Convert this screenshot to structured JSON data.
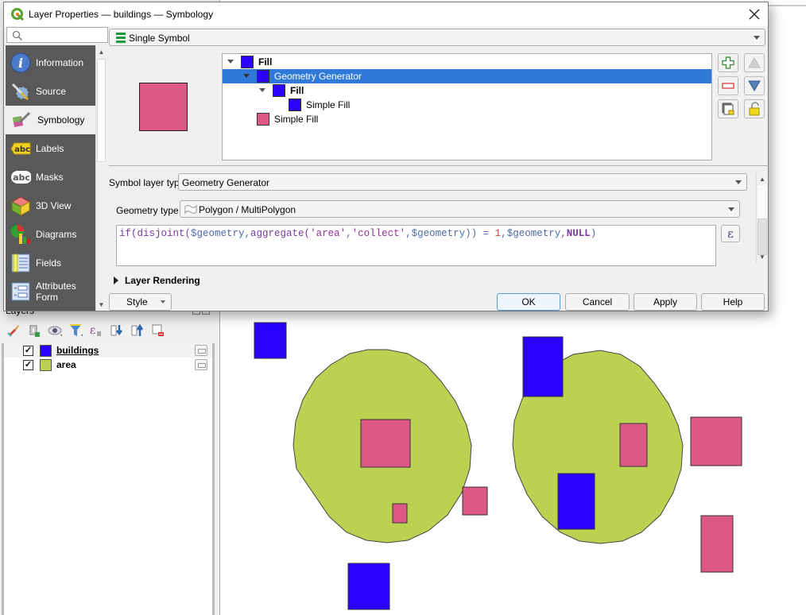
{
  "dialog": {
    "title": "Layer Properties — buildings — Symbology",
    "search_placeholder": "",
    "sidebar": {
      "items": [
        {
          "label": "Information",
          "icon": "information-icon"
        },
        {
          "label": "Source",
          "icon": "source-icon"
        },
        {
          "label": "Symbology",
          "icon": "symbology-icon",
          "active": true
        },
        {
          "label": "Labels",
          "icon": "labels-icon"
        },
        {
          "label": "Masks",
          "icon": "masks-icon"
        },
        {
          "label": "3D View",
          "icon": "3d-view-icon"
        },
        {
          "label": "Diagrams",
          "icon": "diagrams-icon"
        },
        {
          "label": "Fields",
          "icon": "fields-icon"
        },
        {
          "label": "Attributes Form",
          "label_line1": "Attributes",
          "label_line2": "Form",
          "icon": "attributes-form-icon"
        }
      ]
    },
    "renderer": {
      "label": "Single Symbol",
      "icon": "single-symbol-icon"
    },
    "preview_color": "#de5887",
    "symbol_tree": [
      {
        "label": "Fill",
        "bold": true,
        "level": 0,
        "expanded": true,
        "color": "#2a00ff"
      },
      {
        "label": "Geometry Generator",
        "bold": false,
        "level": 1,
        "expanded": true,
        "color": "#2a00ff",
        "selected": true
      },
      {
        "label": "Fill",
        "bold": true,
        "level": 2,
        "expanded": true,
        "color": "#2a00ff"
      },
      {
        "label": "Simple Fill",
        "bold": false,
        "level": 3,
        "color": "#2a00ff"
      },
      {
        "label": "Simple Fill",
        "bold": false,
        "level": 1,
        "color": "#de5887"
      }
    ],
    "layer_buttons": {
      "add": "add-symbol-layer",
      "remove": "remove-symbol-layer",
      "duplicate": "duplicate-symbol-layer",
      "move_up": "move-up",
      "move_down": "move-down",
      "lock": "lock-layer"
    },
    "symbol_layer_type": {
      "label": "Symbol layer type",
      "value": "Geometry Generator"
    },
    "geometry_type": {
      "label": "Geometry type",
      "value": "Polygon / MultiPolygon"
    },
    "expression": {
      "text": "if(disjoint($geometry,aggregate('area','collect',$geometry)) = 1,$geometry,NULL)",
      "tokens": [
        {
          "t": "if(disjoint(",
          "c": "fn"
        },
        {
          "t": "$geometry",
          "c": "var"
        },
        {
          "t": ",",
          "c": "op"
        },
        {
          "t": "aggregate(",
          "c": "fn"
        },
        {
          "t": "'area'",
          "c": "str"
        },
        {
          "t": ",",
          "c": "op"
        },
        {
          "t": "'collect'",
          "c": "str"
        },
        {
          "t": ",",
          "c": "op"
        },
        {
          "t": "$geometry",
          "c": "var"
        },
        {
          "t": ")) = ",
          "c": "op"
        },
        {
          "t": "1",
          "c": "num"
        },
        {
          "t": ",",
          "c": "op"
        },
        {
          "t": "$geometry",
          "c": "var"
        },
        {
          "t": ",",
          "c": "op"
        },
        {
          "t": "NULL",
          "c": "kw"
        },
        {
          "t": ")",
          "c": "op"
        }
      ],
      "button_glyph": "ε"
    },
    "layer_rendering_label": "Layer Rendering",
    "buttons": {
      "style": "Style",
      "ok": "OK",
      "cancel": "Cancel",
      "apply": "Apply",
      "help": "Help"
    }
  },
  "layers_panel": {
    "title": "Layers",
    "layers": [
      {
        "name": "buildings",
        "visible": true,
        "color": "#2a00ff",
        "current": true
      },
      {
        "name": "area",
        "visible": true,
        "color": "#bcd152",
        "current": false
      }
    ]
  },
  "map": {
    "colors": {
      "area": "#bcd152",
      "building_outside": "#2a00ff",
      "building_inside": "#de5887"
    }
  }
}
